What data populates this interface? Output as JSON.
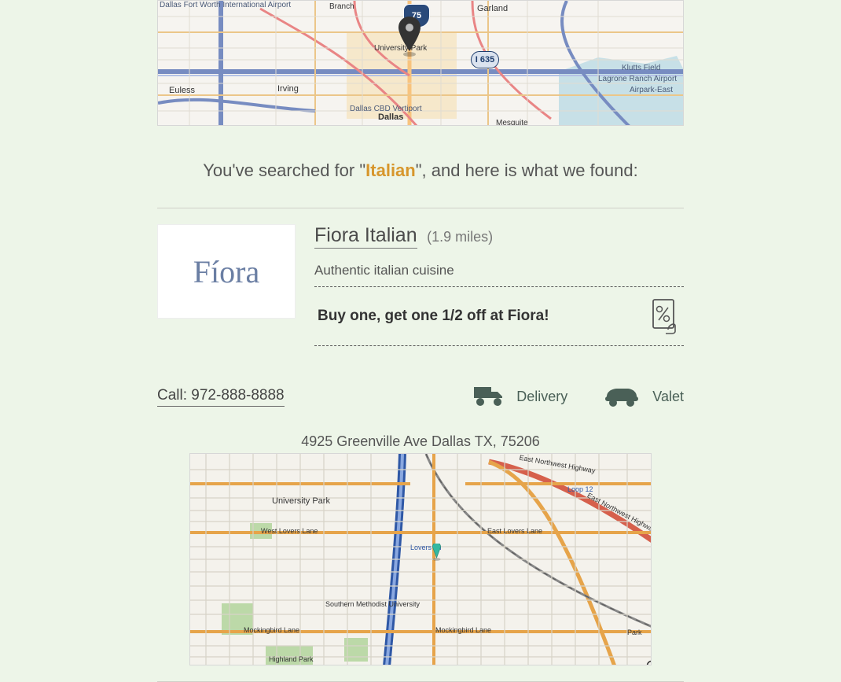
{
  "search": {
    "prefix": "You've searched for \"",
    "term": "Italian",
    "suffix": "\", and here is what we found:"
  },
  "top_map": {
    "labels": {
      "dallas": "Dallas",
      "irving": "Irving",
      "garland": "Garland",
      "branch": "Branch",
      "euless": "Euless",
      "univ_park": "University Park",
      "mesquite": "Mesquite",
      "dfw": "Dallas Fort Worth International Airport",
      "klutts": "Klutts Field",
      "lagrone": "Lagrone Ranch Airport",
      "airpark": "Airpark-East",
      "vertiport": "Dallas CBD Vertiport"
    },
    "shields": {
      "us75": "75",
      "i635": "I 635"
    }
  },
  "result": {
    "logo_text": "Fíora",
    "name": "Fiora Italian",
    "distance": "(1.9 miles)",
    "tagline": "Authentic italian cuisine",
    "offer": "Buy one, get one 1/2 off at Fiora!",
    "call": "Call: 972-888-8888",
    "feature_delivery": "Delivery",
    "feature_valet": "Valet",
    "address": "4925 Greenville Ave Dallas TX, 75206"
  },
  "loc_map": {
    "labels": {
      "univ_park": "University Park",
      "lovers_w": "West Lovers Lane",
      "lovers_e": "East Lovers Lane",
      "mocking_w": "Mockingbird Lane",
      "mocking_e": "Mockingbird Lane",
      "lovers_ln": "Lovers Ln",
      "smu": "Southern Methodist University",
      "highland": "Highland Park",
      "loop12": "Loop 12",
      "nw_hwy_e": "East Northwest Highway",
      "nw_hwy_e2": "East Northwest Highway",
      "park": "Park"
    }
  }
}
